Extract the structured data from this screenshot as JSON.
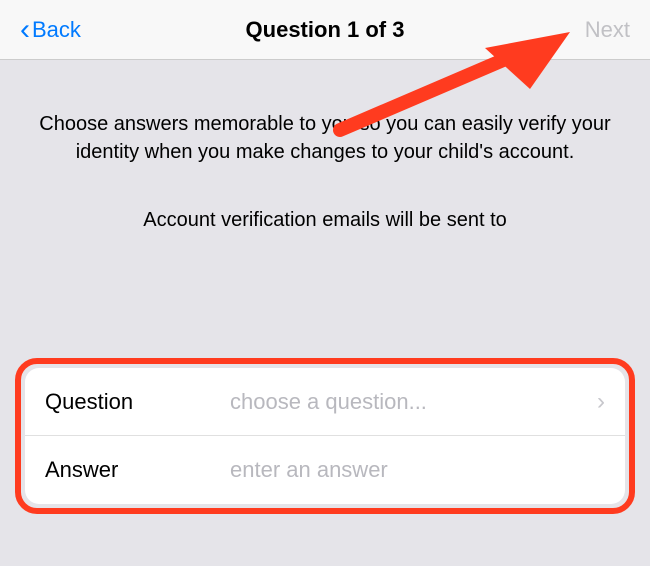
{
  "navbar": {
    "back_label": "Back",
    "title": "Question 1 of 3",
    "next_label": "Next"
  },
  "content": {
    "instruction": "Choose answers memorable to you so you can easily verify your identity when you make changes to your child's account.",
    "verification": "Account verification emails will be sent to"
  },
  "form": {
    "question_label": "Question",
    "question_placeholder": "choose a question...",
    "answer_label": "Answer",
    "answer_placeholder": "enter an answer"
  }
}
